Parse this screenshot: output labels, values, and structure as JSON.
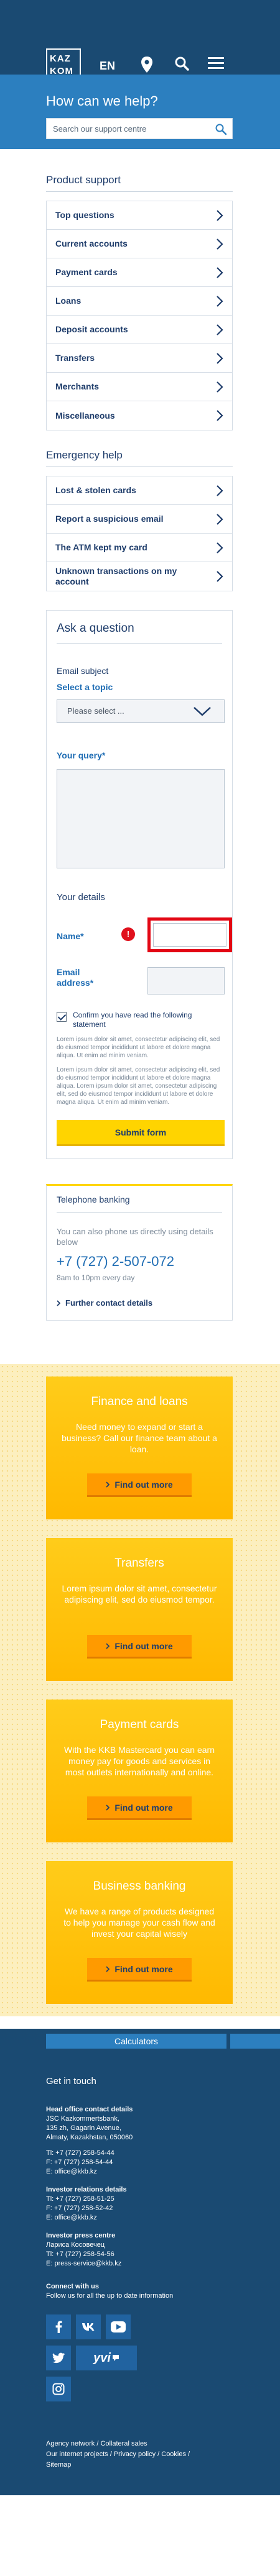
{
  "header": {
    "logo_line1": "KAZ",
    "logo_line2": "KOM",
    "language": "EN",
    "icons": [
      "map-pin-icon",
      "search-icon",
      "menu-icon"
    ]
  },
  "help": {
    "title": "How can we help?",
    "search_placeholder": "Search our support centre"
  },
  "product_support": {
    "title": "Product support",
    "items": [
      "Top questions",
      "Current accounts",
      "Payment cards",
      "Loans",
      "Deposit accounts",
      "Transfers",
      "Merchants",
      "Miscellaneous"
    ]
  },
  "emergency": {
    "title": "Emergency help",
    "items": [
      "Lost & stolen cards",
      "Report a suspicious email",
      "The ATM kept my card",
      "Unknown transactions on my account"
    ]
  },
  "form": {
    "title": "Ask a question",
    "email_subject": "Email subject",
    "select_topic": "Select a topic",
    "select_value": "Please select ...",
    "query_label": "Your query*",
    "your_details": "Your details",
    "name_label": "Name*",
    "required_badge": "!",
    "email_label_1": "Email",
    "email_label_2": "address*",
    "confirm": "Confirm you have read the following statement",
    "lorem1": "Lorem ipsum dolor sit amet, consectetur adipiscing elit, sed do eiusmod tempor incididunt ut labore et dolore magna aliqua. Ut enim ad minim veniam.",
    "lorem2": "Lorem ipsum dolor sit amet, consectetur adipiscing elit, sed do eiusmod tempor incididunt ut labore et dolore magna aliqua. Lorem ipsum dolor sit amet, consectetur adipiscing elit, sed do eiusmod tempor incididunt ut labore et dolore magna aliqua. Ut enim ad minim veniam.",
    "submit": "Submit form"
  },
  "telephone": {
    "title": "Telephone banking",
    "desc": "You can also phone us directly using details below",
    "number": "+7 (727) 2-507-072",
    "hours": "8am to 10pm every day",
    "link": "Further contact details"
  },
  "promos": [
    {
      "title": "Finance and loans",
      "desc": "Need money to expand or start a business? Call our finance team about a loan.",
      "button": "Find out more"
    },
    {
      "title": "Transfers",
      "desc": "Lorem ipsum dolor sit amet, consectetur adipiscing elit, sed do eiusmod tempor.",
      "button": "Find out more"
    },
    {
      "title": "Payment cards",
      "desc": "With the KKB Mastercard you can earn money pay for goods and services in most outlets internationally and online.",
      "button": "Find out more"
    },
    {
      "title": "Business banking",
      "desc": "We have a range of products designed to help you manage your cash flow and invest your capital wisely",
      "button": "Find out more"
    }
  ],
  "footer": {
    "calculators": "Calculators",
    "get_in_touch": "Get in touch",
    "head_office": {
      "heading": "Head office contact details",
      "lines": [
        "JSC Kazkommertsbank,",
        "135 zh, Gagarin Avenue,",
        "Almaty, Kazakhstan, 050060",
        "",
        "Tl: +7 (727) 258-54-44",
        "F: +7 (727) 258-54-44",
        "E: office@kkb.kz"
      ]
    },
    "investor": {
      "heading": "Investor relations details",
      "lines": [
        "Tl: +7 (727) 258-51-25",
        "F: +7 (727) 258-52-42",
        "E: office@kkb.kz"
      ]
    },
    "press": {
      "heading": "Investor press centre",
      "lines": [
        "Лариса Косовечец",
        "Tl: +7 (727) 258-54-56",
        "E: press-service@kkb.kz"
      ]
    },
    "connect": {
      "heading": "Connect with us",
      "lines": [
        "Follow us for all the up to date information"
      ]
    },
    "social": [
      "facebook-icon",
      "vk-icon",
      "youtube-icon",
      "twitter-icon",
      "yvi-icon",
      "instagram-icon"
    ],
    "social_yvi_label": "yvi",
    "bottom_links": [
      "Agency network",
      "Collateral sales",
      "Our internet projects",
      "Privacy policy",
      "Cookies",
      "Sitemap"
    ]
  }
}
